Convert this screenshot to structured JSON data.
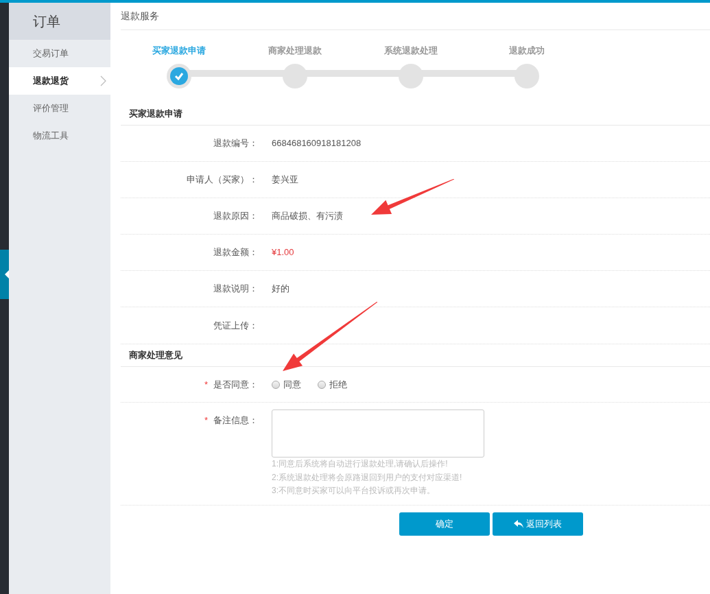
{
  "sidebar": {
    "title": "订单",
    "items": [
      {
        "label": "交易订单",
        "selected": false
      },
      {
        "label": "退款退货",
        "selected": true
      },
      {
        "label": "评价管理",
        "selected": false
      },
      {
        "label": "物流工具",
        "selected": false
      }
    ]
  },
  "page_title": "退款服务",
  "steps": [
    {
      "label": "买家退款申请",
      "completed": true
    },
    {
      "label": "商家处理退款",
      "completed": false
    },
    {
      "label": "系统退款处理",
      "completed": false
    },
    {
      "label": "退款成功",
      "completed": false
    }
  ],
  "buyer_section": {
    "title": "买家退款申请",
    "rows": [
      {
        "label": "退款编号：",
        "value": "668468160918181208",
        "kind": "text"
      },
      {
        "label": "申请人（买家）：",
        "value": "姜兴亚",
        "kind": "text"
      },
      {
        "label": "退款原因：",
        "value": "商品破损、有污渍",
        "kind": "text"
      },
      {
        "label": "退款金额：",
        "value": "¥1.00",
        "kind": "amount"
      },
      {
        "label": "退款说明：",
        "value": "好的",
        "kind": "text"
      },
      {
        "label": "凭证上传："
      }
    ]
  },
  "merchant_section": {
    "title": "商家处理意见",
    "agree": {
      "required_mark": "*",
      "label": "是否同意：",
      "options": [
        {
          "label": "同意",
          "checked": false
        },
        {
          "label": "拒绝",
          "checked": false
        }
      ]
    },
    "remark": {
      "required_mark": "*",
      "label": "备注信息：",
      "hints": [
        "1:同意后系统将自动进行退款处理,请确认后操作!",
        "2:系统退款处理将会原路退回到用户的支付对应渠道!",
        "3:不同意时买家可以向平台投诉或再次申请。"
      ]
    }
  },
  "buttons": [
    {
      "label": "确定",
      "kind": "submit"
    },
    {
      "label": "返回列表",
      "kind": "back"
    }
  ]
}
